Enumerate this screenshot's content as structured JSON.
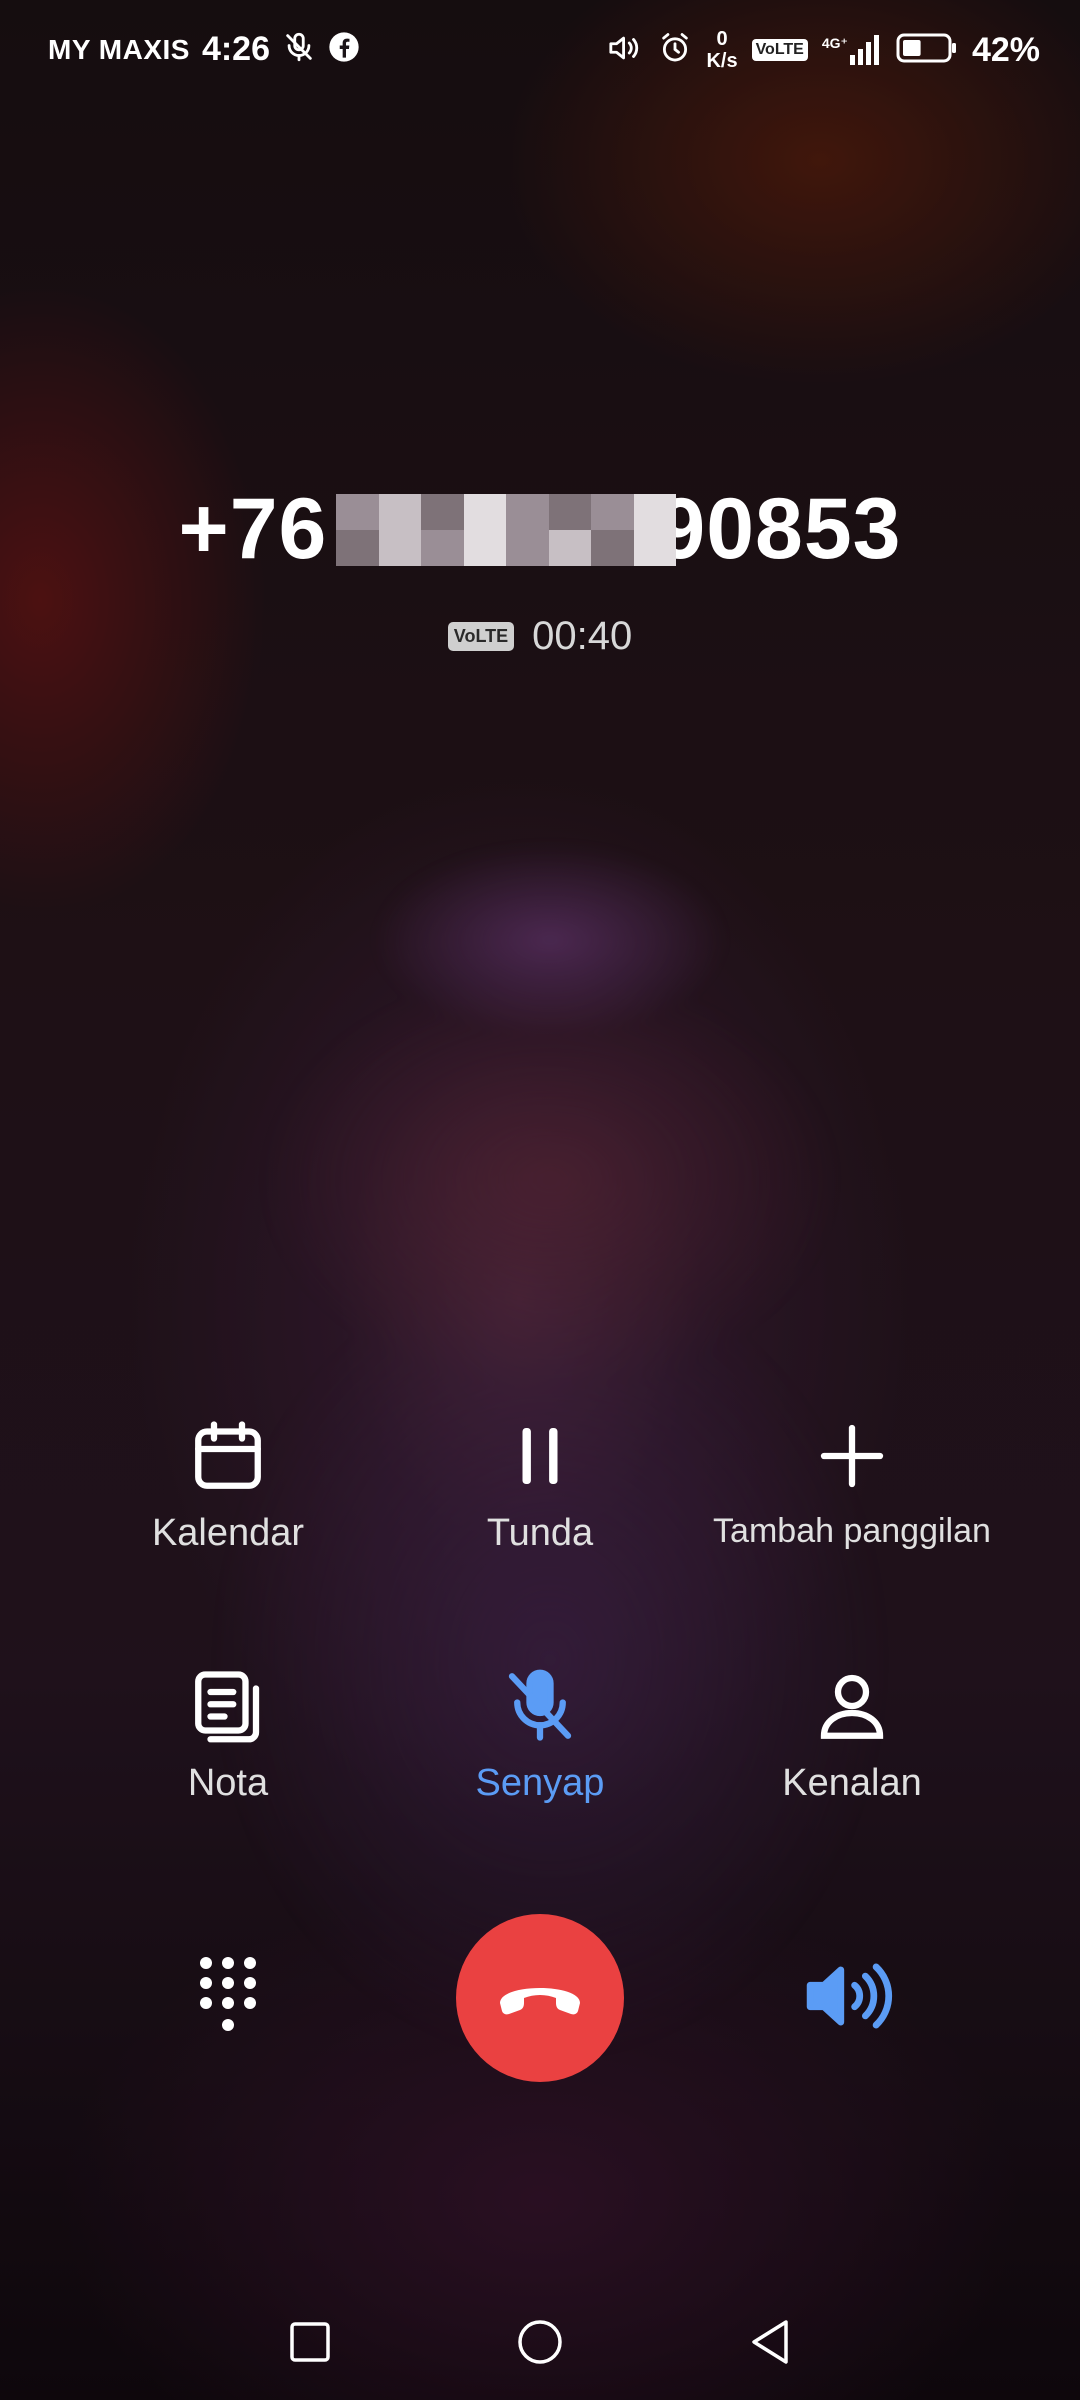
{
  "status_bar": {
    "carrier": "MY MAXIS",
    "time": "4:26",
    "net_speed_value": "0",
    "net_speed_unit": "K/s",
    "volte_label": "VoLTE",
    "network_type": "4G⁺",
    "battery_percent": "42%",
    "battery_level": 0.42,
    "icons": [
      "mic-off-icon",
      "facebook-icon",
      "volume-icon",
      "alarm-icon",
      "signal-icon",
      "battery-icon"
    ]
  },
  "call": {
    "number_prefix": "+76",
    "number_suffix": "90853",
    "volte_label": "VoLTE",
    "duration": "00:40"
  },
  "actions": [
    {
      "label": "Kalendar",
      "icon": "calendar-icon",
      "active": false
    },
    {
      "label": "Tunda",
      "icon": "pause-icon",
      "active": false
    },
    {
      "label": "Tambah panggilan",
      "icon": "plus-icon",
      "active": false
    },
    {
      "label": "Nota",
      "icon": "notes-icon",
      "active": false
    },
    {
      "label": "Senyap",
      "icon": "mute-icon",
      "active": true
    },
    {
      "label": "Kenalan",
      "icon": "contact-icon",
      "active": false
    }
  ],
  "controls": {
    "dialpad_icon": "dialpad-icon",
    "end_call_icon": "end-call-icon",
    "speaker_icon": "speaker-icon",
    "speaker_active": true
  },
  "colors": {
    "accent": "#5b9cf5",
    "end_call": "#ea4141"
  },
  "nav": [
    "recents-icon",
    "home-icon",
    "back-icon"
  ]
}
